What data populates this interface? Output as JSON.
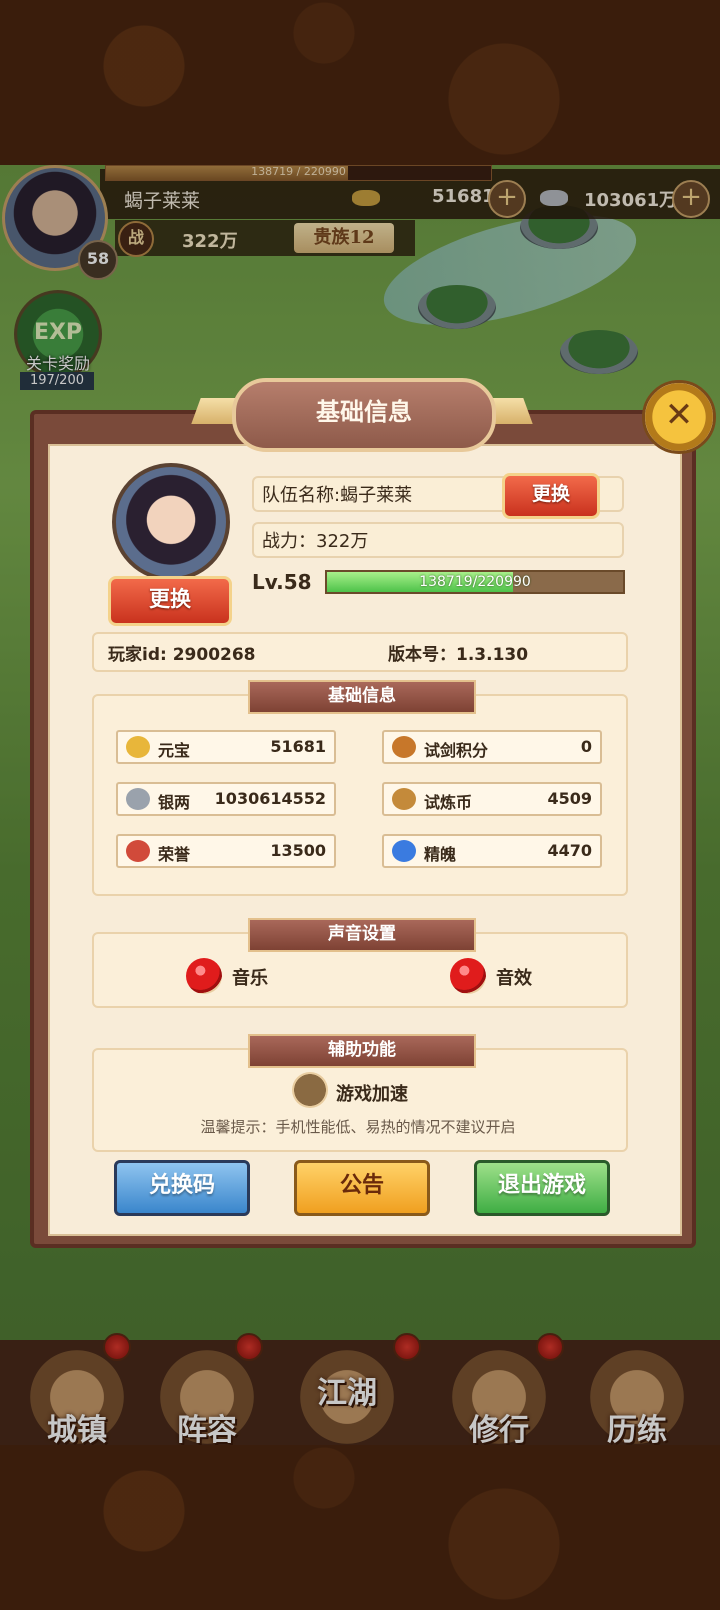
{
  "hud": {
    "exp_text": "138719 / 220990",
    "exp_ratio": 0.628,
    "player_name": "蝎子莱莱",
    "gold_value": "51681",
    "silver_value": "103061万",
    "power_icon": "战",
    "power_value": "322万",
    "noble_label": "贵族12",
    "avatar_level": "58",
    "stage_reward_icon": "EXP",
    "stage_reward_label": "关卡奖励",
    "stage_reward_count": "197/200"
  },
  "modal": {
    "title": "基础信息",
    "close_icon": "close-x-icon",
    "change_avatar_label": "更换",
    "team_name_text": "队伍名称:蝎子莱莱",
    "change_name_label": "更换",
    "power_text": "战力：322万",
    "level_text": "Lv.58",
    "exp_text": "138719/220990",
    "exp_ratio": 0.628,
    "player_id_text": "玩家id: 2900268",
    "version_text": "版本号：1.3.130",
    "stats_heading": "基础信息",
    "stats": [
      {
        "name": "元宝",
        "value": "51681",
        "icon": "gold-ingot-icon",
        "color": "#e8b63a"
      },
      {
        "name": "试剑积分",
        "value": "0",
        "icon": "sword-points-icon",
        "color": "#c7772a"
      },
      {
        "name": "银两",
        "value": "1030614552",
        "icon": "silver-ingot-icon",
        "color": "#9aa2ac"
      },
      {
        "name": "试炼币",
        "value": "4509",
        "icon": "trial-coin-icon",
        "color": "#c48a3a"
      },
      {
        "name": "荣誉",
        "value": "13500",
        "icon": "honor-icon",
        "color": "#d14a3a"
      },
      {
        "name": "精魄",
        "value": "4470",
        "icon": "soul-icon",
        "color": "#3a7be0"
      }
    ],
    "sound_heading": "声音设置",
    "music_label": "音乐",
    "sfx_label": "音效",
    "aux_heading": "辅助功能",
    "speed_label": "游戏加速",
    "tip_text": "温馨提示：手机性能低、易热的情况不建议开启",
    "redeem_label": "兑换码",
    "notice_label": "公告",
    "quit_label": "退出游戏"
  },
  "nav": {
    "items": [
      {
        "label": "城镇"
      },
      {
        "label": "阵容"
      },
      {
        "label": "江湖"
      },
      {
        "label": "修行"
      },
      {
        "label": "历练"
      }
    ]
  },
  "colors": {
    "accent_red": "#d6402a",
    "exp_green": "#4ec24a",
    "panel_bg": "#f8ecd8",
    "frame": "#7a4a3a"
  }
}
